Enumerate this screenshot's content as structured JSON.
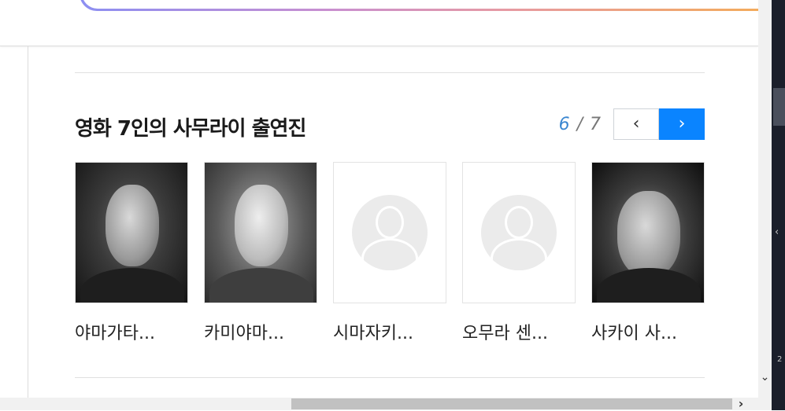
{
  "section": {
    "title": "영화 7인의 사무라이 출연진"
  },
  "pager": {
    "current": "6",
    "separator": "/",
    "total": "7",
    "prev_icon": "‹",
    "next_icon": "›"
  },
  "cast": [
    {
      "name": "야마가타...",
      "photo": "actor-portrait"
    },
    {
      "name": "카미야마...",
      "photo": "actor-portrait"
    },
    {
      "name": "시마자키...",
      "photo": "default-profile-icon"
    },
    {
      "name": "오무라 센...",
      "photo": "default-profile-icon"
    },
    {
      "name": "사카이 사...",
      "photo": "actor-portrait"
    }
  ],
  "right_panel": {
    "partial_text": "2"
  },
  "colors": {
    "accent": "#0a84ff",
    "pager_current": "#3a86d0",
    "search_gradient": [
      "#8c8ff2",
      "#c88fd0",
      "#e69aa3",
      "#f5ad54"
    ]
  }
}
